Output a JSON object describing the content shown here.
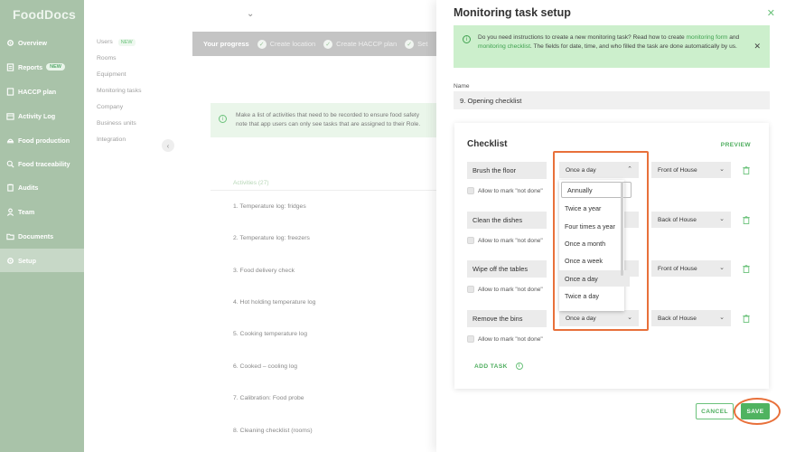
{
  "app": {
    "logo": "FoodDocs"
  },
  "sidebar": {
    "items": [
      {
        "label": "Overview",
        "icon": "gear-icon"
      },
      {
        "label": "Reports",
        "icon": "report-icon",
        "badge": "NEW"
      },
      {
        "label": "HACCP plan",
        "icon": "document-icon"
      },
      {
        "label": "Activity Log",
        "icon": "calendar-icon"
      },
      {
        "label": "Food production",
        "icon": "food-icon"
      },
      {
        "label": "Food traceability",
        "icon": "search-icon"
      },
      {
        "label": "Audits",
        "icon": "clipboard-icon"
      },
      {
        "label": "Team",
        "icon": "person-icon"
      },
      {
        "label": "Documents",
        "icon": "folder-icon"
      },
      {
        "label": "Setup",
        "icon": "gear-icon",
        "active": true
      }
    ]
  },
  "subnav": {
    "items": [
      {
        "label": "Users",
        "badge": "NEW"
      },
      {
        "label": "Rooms"
      },
      {
        "label": "Equipment"
      },
      {
        "label": "Monitoring tasks"
      },
      {
        "label": "Company"
      },
      {
        "label": "Business units"
      },
      {
        "label": "Integration"
      }
    ]
  },
  "progress": {
    "title": "Your progress",
    "steps": [
      "Create location",
      "Create HACCP plan",
      "Set"
    ]
  },
  "info": {
    "line1": "Make a list of activities that need to be recorded to ensure food safety",
    "line2": "note that app users can only see tasks that are assigned to their Role."
  },
  "activities": {
    "header": "Activities (27)",
    "items": [
      "1. Temperature log: fridges",
      "2. Temperature log: freezers",
      "3. Food delivery check",
      "4. Hot holding temperature log",
      "5. Cooking temperature log",
      "6. Cooked – cooling log",
      "7. Calibration: Food probe",
      "8. Cleaning checklist (rooms)"
    ]
  },
  "drawer": {
    "title": "Monitoring task setup",
    "notice": {
      "text1": "Do you need instructions to create a new monitoring task? Read how to create ",
      "link1": "monitoring form",
      "text2": "and ",
      "link2": "monitoring checklist",
      "text3": ". The fields for date, time, and who filled the task are done automatically by us."
    },
    "name_label": "Name",
    "name_value": "9. Opening checklist"
  },
  "checklist": {
    "title": "Checklist",
    "preview": "PREVIEW",
    "not_done_label": "Allow to mark \"not done\"",
    "tasks": [
      {
        "name": "Brush the floor",
        "frequency": "Once a day",
        "role": "Front of House"
      },
      {
        "name": "Clean the dishes",
        "frequency": "",
        "role": "Back of House"
      },
      {
        "name": "Wipe off the tables",
        "frequency": "",
        "role": "Front of House"
      },
      {
        "name": "Remove the bins",
        "frequency": "Once a day",
        "role": "Back of House"
      }
    ],
    "add_task": "ADD TASK"
  },
  "dropdown": {
    "options": [
      "Annually",
      "Twice a year",
      "Four times a year",
      "Once a month",
      "Once a week",
      "Once a day",
      "Twice a day"
    ],
    "selected": "Once a day"
  },
  "footer": {
    "cancel": "CANCEL",
    "save": "SAVE"
  },
  "colors": {
    "brand_green": "#4fb360",
    "highlight": "#e8703a",
    "sidebar": "#a9c3a9"
  }
}
